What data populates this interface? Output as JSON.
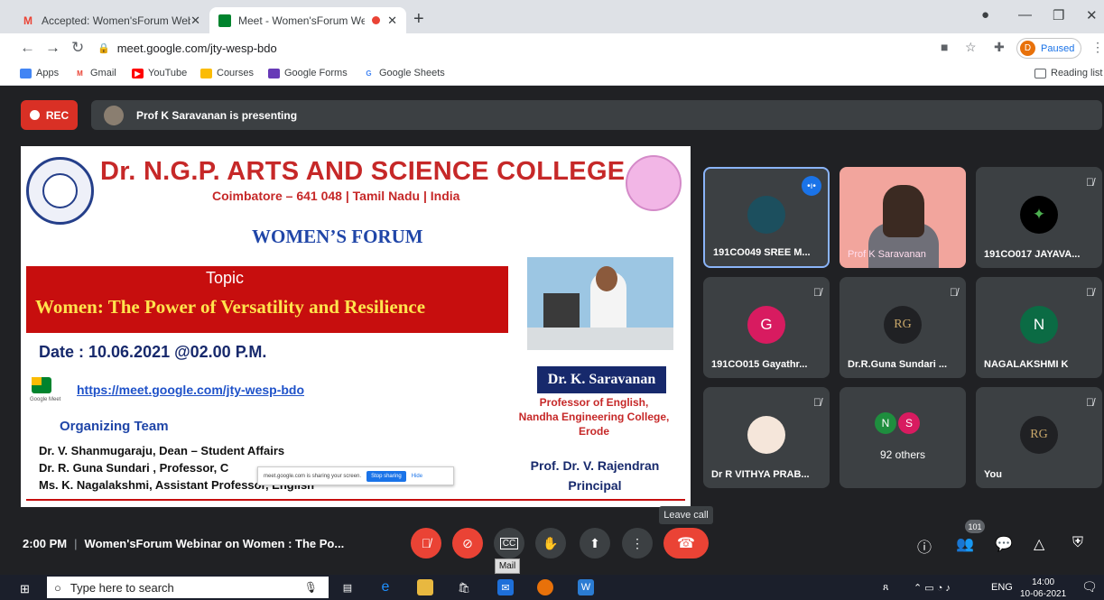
{
  "browser": {
    "tabs": [
      {
        "title": "Accepted: Women'sForum Webir",
        "icon": "gmail-icon"
      },
      {
        "title": "Meet - Women'sForum Web",
        "icon": "meet-icon"
      }
    ],
    "url": "meet.google.com/jty-wesp-bdo",
    "profile_initial": "D",
    "profile_status": "Paused",
    "bookmarks": [
      "Apps",
      "Gmail",
      "YouTube",
      "Courses",
      "Google Forms",
      "Google Sheets"
    ],
    "reading_list": "Reading list"
  },
  "meet": {
    "rec_label": "REC",
    "presenting_text": "Prof K Saravanan is presenting",
    "meeting_time": "2:00 PM",
    "meeting_title": "Women'sForum Webinar on Women : The Po...",
    "leave_tooltip": "Leave call",
    "mail_tooltip": "Mail",
    "participant_count": "101"
  },
  "slide": {
    "college": "Dr. N.G.P. ARTS AND SCIENCE COLLEGE",
    "location": "Coimbatore – 641 048 | Tamil Nadu | India",
    "forum": "WOMEN’S FORUM",
    "topic_label": "Topic",
    "topic": "Women: The Power of Versatility and Resilience",
    "date": "Date : 10.06.2021 @02.00 P.M.",
    "gm_label": "Google Meet",
    "link": "https://meet.google.com/jty-wesp-bdo",
    "organizing": "Organizing Team",
    "members": [
      "Dr. V. Shanmugaraju, Dean – Student Affairs",
      "Dr. R. Guna Sundari , Professor, C",
      "Ms. K. Nagalakshmi,  Assistant Professor, English"
    ],
    "speaker": "Dr. K. Saravanan",
    "speaker_lines": [
      "Professor of English,",
      "Nandha Engineering College,",
      "Erode"
    ],
    "chief": "Prof. Dr. V. Rajendran",
    "chief_role": "Principal",
    "share_notice": "meet.google.com is sharing your screen.",
    "stop_sharing": "Stop sharing",
    "hide": "Hide"
  },
  "tiles": [
    {
      "name": "191CO049 SREE M...",
      "avatar": "flower-photo-avatar"
    },
    {
      "name": "Prof K Saravanan",
      "avatar": "camera-feed"
    },
    {
      "name": "191CO017 JAYAVA...",
      "avatar": "bird-logo-avatar"
    },
    {
      "name": "191CO015 Gayathr...",
      "initial": "G",
      "color": "#d81b60"
    },
    {
      "name": "Dr.R.Guna Sundari ...",
      "initial": "RG",
      "color": "#202124"
    },
    {
      "name": "NAGALAKSHMI K",
      "initial": "N",
      "color": "#0b6b44"
    },
    {
      "name": "Dr R VITHYA PRAB...",
      "avatar": "portrait-photo-avatar"
    },
    {
      "name": "92 others",
      "initials": [
        "N",
        "S"
      ],
      "colors": [
        "#1e8e3e",
        "#d81b60"
      ]
    },
    {
      "name": "You",
      "initial": "RG",
      "color": "#202124"
    }
  ],
  "taskbar": {
    "search_placeholder": "Type here to search",
    "lang": "ENG",
    "time": "14:00",
    "date": "10-06-2021"
  }
}
